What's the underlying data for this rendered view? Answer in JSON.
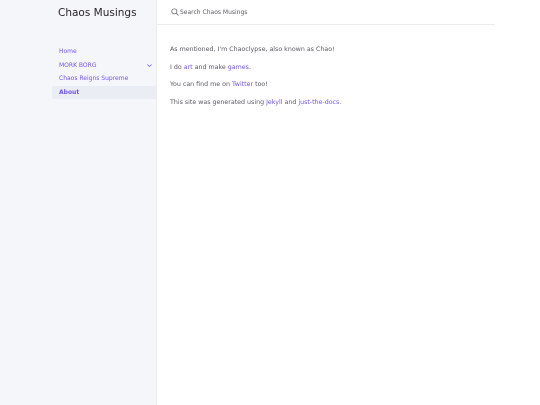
{
  "site_title": "Chaos Musings",
  "search": {
    "placeholder": "Search Chaos Musings"
  },
  "nav": {
    "items": [
      {
        "label": "Home"
      },
      {
        "label": "MORK BORG"
      },
      {
        "label": "Chaos Reigns Supreme"
      },
      {
        "label": "About"
      }
    ]
  },
  "content": {
    "p1": "As mentioned, I'm Chaoclypse, also known as Chao!",
    "p2": {
      "before": "I do ",
      "link1": "art",
      "middle": " and make ",
      "link2": "games",
      "after": "."
    },
    "p3": {
      "before": "You can find me on ",
      "link": "Twitter",
      "after": " too!"
    },
    "p4": {
      "before": "This site was generated using ",
      "link1": "Jekyll",
      "middle": " and ",
      "link2": "just-the-docs",
      "after": "."
    }
  },
  "colors": {
    "link": "#7253ed",
    "text": "#5c5962",
    "sidebar_bg": "#f5f6fa",
    "active_bg": "#ebedf5"
  }
}
